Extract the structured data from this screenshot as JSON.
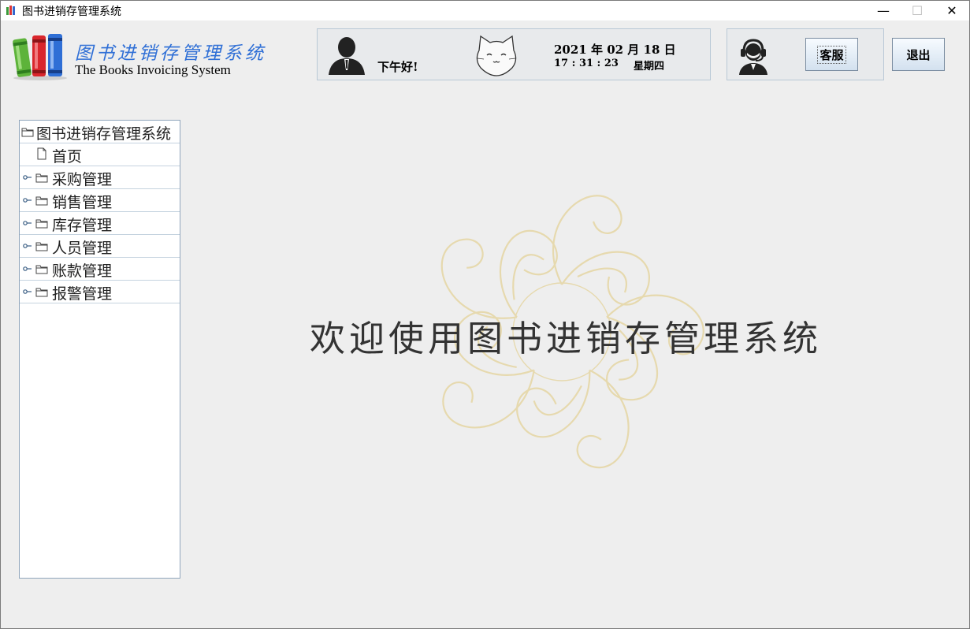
{
  "window": {
    "title": "图书进销存管理系统",
    "controls": {
      "minimize": "—",
      "maximize": "☐",
      "close": "✕"
    }
  },
  "header": {
    "logo_cn": "图书进销存管理系统",
    "logo_en": "The Books Invoicing System",
    "logo_icon": "books-logo-icon",
    "greeting": "下午好!",
    "date": "2021 年 02 月 18 日",
    "time": "17 : 31 : 23",
    "weekday": "星期四",
    "service_button": "客服",
    "exit_button": "退出"
  },
  "tree": {
    "root": "图书进销存管理系统",
    "items": [
      {
        "label": "首页",
        "icon": "file-icon"
      },
      {
        "label": "采购管理",
        "icon": "folder-icon"
      },
      {
        "label": "销售管理",
        "icon": "folder-icon"
      },
      {
        "label": "库存管理",
        "icon": "folder-icon"
      },
      {
        "label": "人员管理",
        "icon": "folder-icon"
      },
      {
        "label": "账款管理",
        "icon": "folder-icon"
      },
      {
        "label": "报警管理",
        "icon": "folder-icon"
      }
    ]
  },
  "main": {
    "welcome": "欢迎使用图书进销存管理系统"
  },
  "colors": {
    "logo_text": "#2f6fd6",
    "panel_border": "#b9c8d6",
    "watermark": "#e6d7a8"
  }
}
